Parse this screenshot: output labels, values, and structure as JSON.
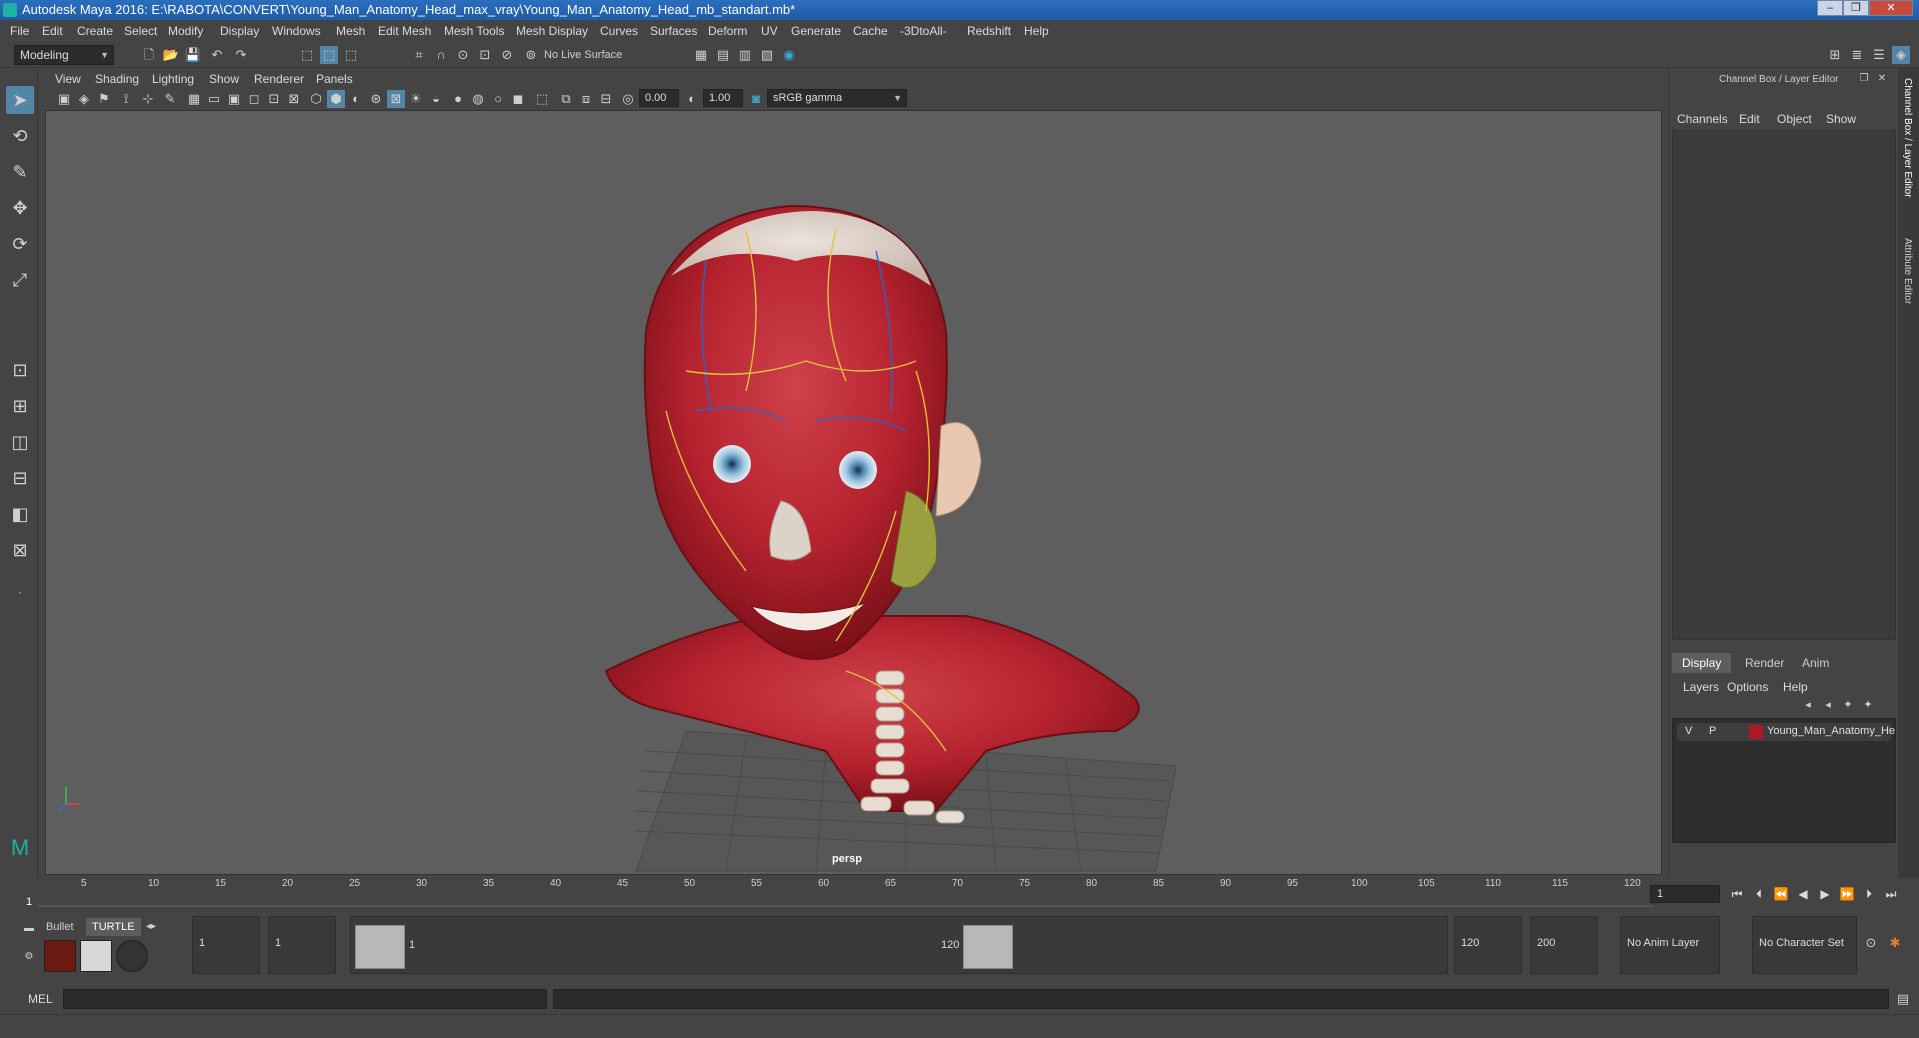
{
  "window": {
    "title": "Autodesk Maya 2016: E:\\RABOTA\\CONVERT\\Young_Man_Anatomy_Head_max_vray\\Young_Man_Anatomy_Head_mb_standart.mb*",
    "minimize": "–",
    "maximize": "❐",
    "close": "✕"
  },
  "menubar": [
    "File",
    "Edit",
    "Create",
    "Select",
    "Modify",
    "Display",
    "Windows",
    "Mesh",
    "Edit Mesh",
    "Mesh Tools",
    "Mesh Display",
    "Curves",
    "Surfaces",
    "Deform",
    "UV",
    "Generate",
    "Cache",
    "-3DtoAll-",
    "Redshift",
    "Help"
  ],
  "statusline": {
    "mode": "Modeling",
    "live_surface": "No Live Surface"
  },
  "panel": {
    "menus": [
      "View",
      "Shading",
      "Lighting",
      "Show",
      "Renderer",
      "Panels"
    ],
    "exposure": "0.00",
    "gamma": "1.00",
    "color_space": "sRGB gamma",
    "camera_label": "persp"
  },
  "rightpanel": {
    "header": "Channel Box / Layer Editor",
    "channel_menus": [
      "Channels",
      "Edit",
      "Object",
      "Show"
    ],
    "tabs": [
      "Display",
      "Render",
      "Anim"
    ],
    "active_tab": "Display",
    "layer_menus": [
      "Layers",
      "Options",
      "Help"
    ],
    "layer": {
      "v": "V",
      "p": "P",
      "name": "Young_Man_Anatomy_He",
      "color": "#b0162a"
    },
    "side_tabs": [
      "Channel Box / Layer Editor",
      "Attribute Editor"
    ]
  },
  "timeslider": {
    "ticks": [
      "5",
      "10",
      "15",
      "20",
      "25",
      "30",
      "35",
      "40",
      "45",
      "50",
      "55",
      "60",
      "65",
      "70",
      "75",
      "80",
      "85",
      "90",
      "95",
      "100",
      "105",
      "110",
      "115",
      "120"
    ],
    "current": "1",
    "current_field": "1"
  },
  "range": {
    "start": "1",
    "start2": "1",
    "range_start": "1",
    "range_end": "120",
    "end": "120",
    "end2": "200",
    "anim_layer": "No Anim Layer",
    "character_set": "No Character Set"
  },
  "shelf": {
    "tabs": [
      "Bullet",
      "TURTLE"
    ],
    "active_tab": "TURTLE"
  },
  "cmdline": {
    "label": "MEL"
  }
}
